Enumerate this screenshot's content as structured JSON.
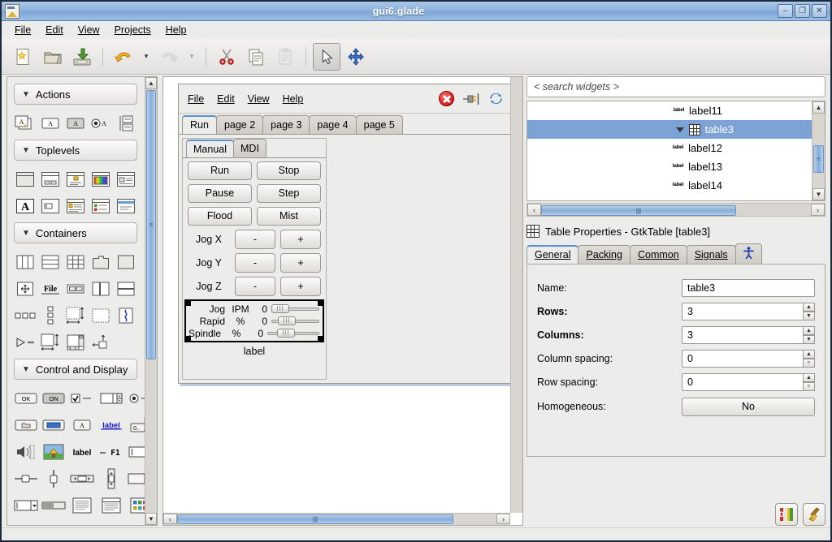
{
  "window": {
    "title": "gui6.glade",
    "icon": "glade-document-icon",
    "buttons": [
      {
        "name": "minimize-button",
        "glyph": "–"
      },
      {
        "name": "maximize-button",
        "glyph": "❐"
      },
      {
        "name": "close-button",
        "glyph": "✕"
      }
    ]
  },
  "menubar": {
    "items": [
      {
        "label": "File",
        "mnemonic": "F"
      },
      {
        "label": "Edit",
        "mnemonic": "E"
      },
      {
        "label": "View",
        "mnemonic": "V"
      },
      {
        "label": "Projects",
        "mnemonic": "P"
      },
      {
        "label": "Help",
        "mnemonic": "H"
      }
    ]
  },
  "toolbar": {
    "items": [
      {
        "name": "new-button",
        "icon": "new-document-icon",
        "enabled": true
      },
      {
        "name": "open-button",
        "icon": "open-folder-icon",
        "enabled": true
      },
      {
        "name": "save-button",
        "icon": "save-disk-icon",
        "enabled": true
      },
      {
        "name": "undo-button",
        "icon": "undo-arrow-icon",
        "enabled": true
      },
      {
        "name": "undo-dropdown",
        "icon": "chevron-down-icon",
        "enabled": true
      },
      {
        "name": "redo-button",
        "icon": "redo-arrow-icon",
        "enabled": false
      },
      {
        "name": "redo-dropdown",
        "icon": "chevron-down-icon",
        "enabled": false
      },
      {
        "name": "cut-button",
        "icon": "scissors-icon",
        "enabled": true
      },
      {
        "name": "copy-button",
        "icon": "copy-pages-icon",
        "enabled": true
      },
      {
        "name": "paste-button",
        "icon": "clipboard-icon",
        "enabled": false
      },
      {
        "name": "select-tool",
        "icon": "mouse-pointer-icon",
        "enabled": true,
        "active": true
      },
      {
        "name": "drag-resize-tool",
        "icon": "move-cross-icon",
        "enabled": true
      }
    ]
  },
  "palette": {
    "sections": [
      {
        "title": "Actions",
        "expanded": true,
        "items": [
          {
            "name": "action-group-item",
            "icon": "action-group-icon"
          },
          {
            "name": "action-item",
            "icon": "action-icon"
          },
          {
            "name": "toggle-action-item",
            "icon": "toggle-action-icon"
          },
          {
            "name": "radio-action-item",
            "icon": "radio-action-icon"
          },
          {
            "name": "recent-action-item",
            "icon": "recent-action-icon"
          }
        ]
      },
      {
        "title": "Toplevels",
        "expanded": true,
        "items": [
          {
            "name": "window-item",
            "icon": "window-icon"
          },
          {
            "name": "dialog-item",
            "icon": "dialog-icon"
          },
          {
            "name": "message-dialog-item",
            "icon": "message-dialog-icon"
          },
          {
            "name": "color-selection-dialog-item",
            "icon": "color-dialog-icon"
          },
          {
            "name": "file-chooser-dialog-item",
            "icon": "file-chooser-dialog-icon"
          },
          {
            "name": "font-selection-dialog-item",
            "icon": "font-dialog-icon"
          },
          {
            "name": "input-dialog-item",
            "icon": "input-dialog-icon"
          },
          {
            "name": "about-dialog-item",
            "icon": "about-dialog-icon"
          },
          {
            "name": "assistant-item",
            "icon": "assistant-icon"
          },
          {
            "name": "offscreen-window-item",
            "icon": "offscreen-window-icon"
          }
        ]
      },
      {
        "title": "Containers",
        "expanded": true,
        "items": [
          {
            "name": "hbox-item",
            "icon": "hbox-icon"
          },
          {
            "name": "vbox-item",
            "icon": "vbox-icon"
          },
          {
            "name": "table-item",
            "icon": "table-icon"
          },
          {
            "name": "notebook-item",
            "icon": "notebook-icon"
          },
          {
            "name": "frame-item",
            "icon": "frame-icon"
          },
          {
            "name": "alignment-item",
            "icon": "alignment-icon"
          },
          {
            "name": "file-chooser-widget-item",
            "icon": "file-chooser-widget-icon"
          },
          {
            "name": "hbutton-box-item",
            "icon": "hbutton-box-icon"
          },
          {
            "name": "hpaned-item",
            "icon": "hpaned-icon"
          },
          {
            "name": "vpaned-item",
            "icon": "vpaned-icon"
          },
          {
            "name": "toolbar-item",
            "icon": "toolbar-icon"
          },
          {
            "name": "vbutton-box-item",
            "icon": "vbutton-box-icon"
          },
          {
            "name": "viewport-item",
            "icon": "viewport-icon"
          },
          {
            "name": "event-box-item",
            "icon": "event-box-icon"
          },
          {
            "name": "expander-item",
            "icon": "expander-icon"
          },
          {
            "name": "arrow-item",
            "icon": "arrow-container-icon"
          },
          {
            "name": "scrolled-window-item",
            "icon": "scrolled-window-icon"
          },
          {
            "name": "layout-item",
            "icon": "layout-icon"
          },
          {
            "name": "fixed-item",
            "icon": "fixed-icon"
          }
        ]
      },
      {
        "title": "Control and Display",
        "expanded": true,
        "items": [
          {
            "name": "button-item",
            "icon": "ok-button-icon"
          },
          {
            "name": "toggle-button-item",
            "icon": "on-toggle-icon"
          },
          {
            "name": "check-button-item",
            "icon": "checkbox-icon"
          },
          {
            "name": "spin-button-item",
            "icon": "spin-button-icon"
          },
          {
            "name": "radio-button-item",
            "icon": "radio-button-icon"
          },
          {
            "name": "file-chooser-button-item",
            "icon": "file-chooser-button-icon"
          },
          {
            "name": "color-button-item",
            "icon": "color-button-icon"
          },
          {
            "name": "font-button-item",
            "icon": "font-button-icon"
          },
          {
            "name": "link-button-item",
            "icon": "link-button-icon"
          },
          {
            "name": "scale-button-item",
            "icon": "scale-button-icon"
          },
          {
            "name": "volume-button-item",
            "icon": "volume-button-icon"
          },
          {
            "name": "image-item",
            "icon": "image-icon"
          },
          {
            "name": "label-item",
            "icon": "label-icon"
          },
          {
            "name": "accel-label-item",
            "icon": "accel-label-icon"
          },
          {
            "name": "entry-item",
            "icon": "entry-icon"
          },
          {
            "name": "hscale-item",
            "icon": "hscale-icon"
          },
          {
            "name": "vscale-item",
            "icon": "vscale-icon"
          },
          {
            "name": "hscrollbar-item",
            "icon": "hscrollbar-icon"
          },
          {
            "name": "vscrollbar-item",
            "icon": "vscrollbar-icon"
          },
          {
            "name": "combo-box-item",
            "icon": "combo-box-icon"
          },
          {
            "name": "combo-box-entry-item",
            "icon": "combo-box-entry-icon"
          },
          {
            "name": "progress-bar-item",
            "icon": "progress-bar-icon"
          },
          {
            "name": "text-view-item",
            "icon": "text-view-icon"
          },
          {
            "name": "tree-view-item",
            "icon": "tree-view-icon"
          },
          {
            "name": "icon-view-item",
            "icon": "icon-view-icon"
          }
        ]
      }
    ],
    "scroll": {
      "up": "▲",
      "down": "▼"
    }
  },
  "canvas": {
    "designed_window": {
      "menu": [
        {
          "label": "File",
          "mnemonic": "F"
        },
        {
          "label": "Edit",
          "mnemonic": "E"
        },
        {
          "label": "View",
          "mnemonic": "V"
        },
        {
          "label": "Help",
          "mnemonic": "H"
        }
      ],
      "header_icons": [
        {
          "name": "stop-icon",
          "label": "stop"
        },
        {
          "name": "plug-icon",
          "label": "estop-plug"
        },
        {
          "name": "refresh-icon",
          "label": "refresh"
        }
      ],
      "tabs": [
        {
          "label": "Run",
          "selected": true
        },
        {
          "label": "page 2",
          "selected": false
        },
        {
          "label": "page 3",
          "selected": false
        },
        {
          "label": "page 4",
          "selected": false
        },
        {
          "label": "page 5",
          "selected": false
        }
      ],
      "inner_tabs": [
        {
          "label": "Manual",
          "selected": true
        },
        {
          "label": "MDI",
          "selected": false
        }
      ],
      "buttons": [
        [
          "Run",
          "Stop"
        ],
        [
          "Pause",
          "Step"
        ],
        [
          "Flood",
          "Mist"
        ]
      ],
      "jog_rows": [
        {
          "label": "Jog X",
          "minus": "-",
          "plus": "+"
        },
        {
          "label": "Jog Y",
          "minus": "-",
          "plus": "+"
        },
        {
          "label": "Jog Z",
          "minus": "-",
          "plus": "+"
        }
      ],
      "sliders": [
        {
          "name": "Jog",
          "unit": "IPM",
          "value": "0"
        },
        {
          "name": "Rapid",
          "unit": "%",
          "value": "0"
        },
        {
          "name": "Spindle",
          "unit": "%",
          "value": "0"
        }
      ],
      "footer_label": "label"
    },
    "hscroll": {
      "left_arrow": "‹",
      "right_arrow": "›",
      "grip": "|||"
    }
  },
  "inspector": {
    "search": {
      "placeholder": "< search widgets >",
      "value": ""
    },
    "tree": [
      {
        "label": "label11",
        "icon": "label-icon",
        "indent": 2,
        "selected": false,
        "expander": false
      },
      {
        "label": "table3",
        "icon": "table-icon",
        "indent": 1,
        "selected": true,
        "expander": true
      },
      {
        "label": "label12",
        "icon": "label-icon",
        "indent": 2,
        "selected": false,
        "expander": false
      },
      {
        "label": "label13",
        "icon": "label-icon",
        "indent": 2,
        "selected": false,
        "expander": false
      },
      {
        "label": "label14",
        "icon": "label-icon",
        "indent": 2,
        "selected": false,
        "expander": false
      }
    ],
    "tree_scroll": {
      "up": "▲",
      "down": "▼",
      "left": "‹",
      "right": "›",
      "grip": "|||"
    }
  },
  "properties": {
    "header": "Table Properties - GtkTable [table3]",
    "header_icon": "table-icon",
    "tabs": [
      {
        "label": "General",
        "mnemonic": "G",
        "selected": true
      },
      {
        "label": "Packing",
        "mnemonic": "P",
        "selected": false
      },
      {
        "label": "Common",
        "mnemonic": "C",
        "selected": false
      },
      {
        "label": "Signals",
        "mnemonic": "S",
        "selected": false
      },
      {
        "label": "",
        "icon": "accessibility-icon",
        "selected": false
      }
    ],
    "fields": [
      {
        "label": "Name:",
        "value": "table3",
        "type": "text",
        "bold": false
      },
      {
        "label": "Rows:",
        "value": "3",
        "type": "spin",
        "bold": true
      },
      {
        "label": "Columns:",
        "value": "3",
        "type": "spin",
        "bold": true
      },
      {
        "label": "Column spacing:",
        "value": "0",
        "type": "spin",
        "bold": false,
        "down_disabled": true
      },
      {
        "label": "Row spacing:",
        "value": "0",
        "type": "spin",
        "bold": false,
        "down_disabled": true
      },
      {
        "label": "Homogeneous:",
        "value": "No",
        "type": "button",
        "bold": false
      }
    ],
    "footer_buttons": [
      {
        "name": "devhelp-button",
        "icon": "devhelp-book-icon"
      },
      {
        "name": "clear-button",
        "icon": "broom-icon"
      }
    ]
  },
  "colors": {
    "titlebar": "#8fb4dd",
    "selection": "#7da3d6",
    "panel_bg": "#ececeb",
    "accent_tab": "#5b8fd0"
  }
}
